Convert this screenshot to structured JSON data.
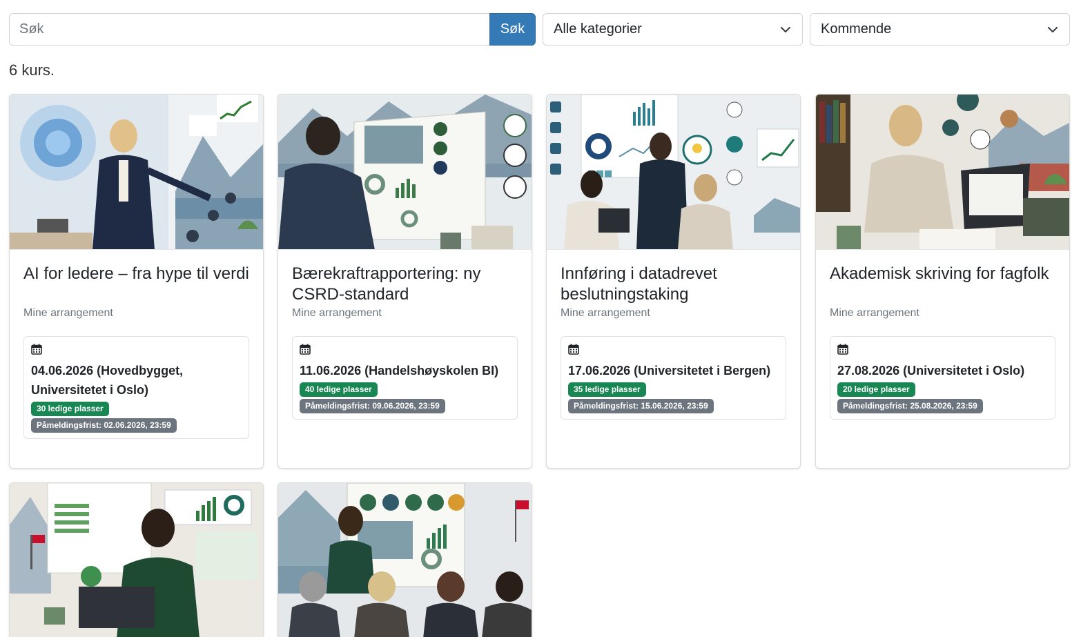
{
  "search": {
    "placeholder": "Søk",
    "button_label": "Søk"
  },
  "filters": {
    "category": "Alle kategorier",
    "time": "Kommende"
  },
  "result_count": "6 kurs.",
  "colors": {
    "primary": "#337ab7",
    "badge_available": "#198754",
    "badge_deadline": "#6c757d"
  },
  "courses": [
    {
      "title": "AI for ledere – fra hype til verdi",
      "subtitle": "Mine arrangement",
      "date": "04.06.2026 (Hovedbygget, Universitetet i Oslo)",
      "availability": "30 ledige plasser",
      "deadline": "Påmeldingsfrist: 02.06.2026, 23:59"
    },
    {
      "title": "Bærekraftrapportering: ny CSRD-standard",
      "subtitle": "Mine arrangement",
      "date": "11.06.2026 (Handelshøyskolen BI)",
      "availability": "40 ledige plasser",
      "deadline": "Påmeldingsfrist: 09.06.2026, 23:59"
    },
    {
      "title": "Innføring i datadrevet beslutningstaking",
      "subtitle": "Mine arrangement",
      "date": "17.06.2026 (Universitetet i Bergen)",
      "availability": "35 ledige plasser",
      "deadline": "Påmeldingsfrist: 15.06.2026, 23:59"
    },
    {
      "title": "Akademisk skriving for fagfolk",
      "subtitle": "Mine arrangement",
      "date": "27.08.2026 (Universitetet i Oslo)",
      "availability": "20 ledige plasser",
      "deadline": "Påmeldingsfrist: 25.08.2026, 23:59"
    }
  ]
}
